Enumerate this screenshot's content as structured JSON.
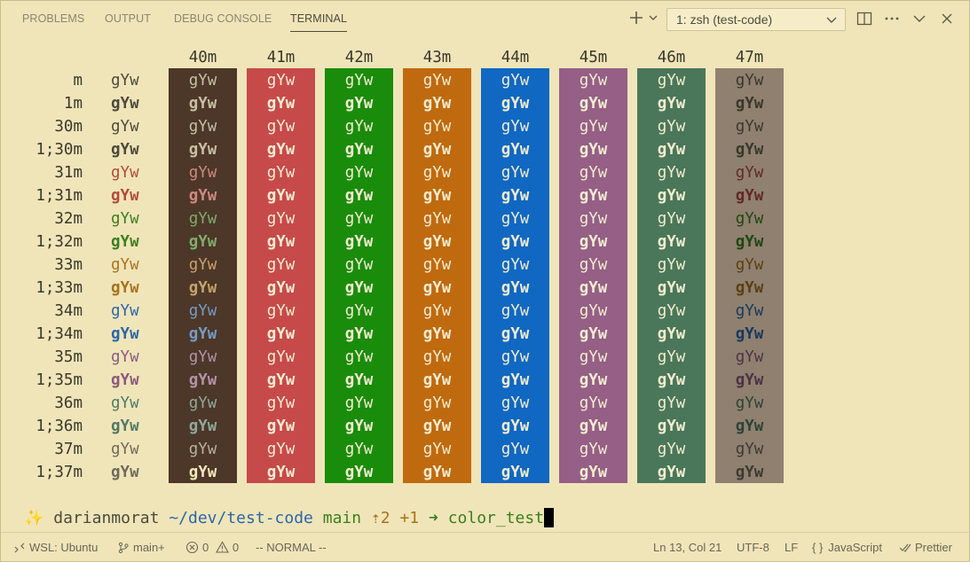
{
  "panel": {
    "tabs": [
      {
        "label": "PROBLEMS"
      },
      {
        "label": "OUTPUT"
      },
      {
        "label": "DEBUG CONSOLE"
      },
      {
        "label": "TERMINAL",
        "active": true
      }
    ],
    "terminal_select": "1: zsh (test-code)",
    "icons": [
      "plus-icon",
      "chevron-down-icon",
      "split-icon",
      "more-icon",
      "chevron-down-icon",
      "close-icon"
    ]
  },
  "terminal": {
    "bg_headers": [
      "40m",
      "41m",
      "42m",
      "43m",
      "44m",
      "45m",
      "46m",
      "47m"
    ],
    "bg_colors": [
      "#4d3728",
      "#c74a4a",
      "#1a8c0b",
      "#c06a0f",
      "#1068c2",
      "#955f86",
      "#4a7759",
      "#8f8070"
    ],
    "sample": "gYw",
    "rows": [
      {
        "label": "m",
        "fg": "#4d4a3b",
        "bold": false
      },
      {
        "label": "1m",
        "fg": "#4d4a3b",
        "bold": true
      },
      {
        "label": "30m",
        "fg": "#4d4a3b",
        "bold": false
      },
      {
        "label": "1;30m",
        "fg": "#4d4a3b",
        "bold": true
      },
      {
        "label": "31m",
        "fg": "#b34a3c",
        "bold": false
      },
      {
        "label": "1;31m",
        "fg": "#b34a3c",
        "bold": true
      },
      {
        "label": "32m",
        "fg": "#3c7f1e",
        "bold": false
      },
      {
        "label": "1;32m",
        "fg": "#3c7f1e",
        "bold": true
      },
      {
        "label": "33m",
        "fg": "#a8721d",
        "bold": false
      },
      {
        "label": "1;33m",
        "fg": "#a8721d",
        "bold": true
      },
      {
        "label": "34m",
        "fg": "#2b66a8",
        "bold": false
      },
      {
        "label": "1;34m",
        "fg": "#2b66a8",
        "bold": true
      },
      {
        "label": "35m",
        "fg": "#8a5a7e",
        "bold": false
      },
      {
        "label": "1;35m",
        "fg": "#8a5a7e",
        "bold": true
      },
      {
        "label": "36m",
        "fg": "#4f7a66",
        "bold": false
      },
      {
        "label": "1;36m",
        "fg": "#4f7a66",
        "bold": true
      },
      {
        "label": "37m",
        "fg": "#6f6a5a",
        "bold": false
      },
      {
        "label": "1;37m",
        "fg": "#6f6a5a",
        "bold": true
      }
    ],
    "prompt": {
      "sparkle": "✨",
      "user": "darianmorat",
      "path": "~/dev/test-code",
      "branch": "main",
      "ahead": "⇡2",
      "changes": "+1",
      "arrow": "➜",
      "command": "color_test"
    }
  },
  "statusbar": {
    "remote": "WSL: Ubuntu",
    "branch": "main+",
    "errors": "0",
    "warnings": "0",
    "mode": "-- NORMAL --",
    "position": "Ln 13, Col 21",
    "encoding": "UTF-8",
    "eol": "LF",
    "language": "JavaScript",
    "formatter": "Prettier"
  }
}
